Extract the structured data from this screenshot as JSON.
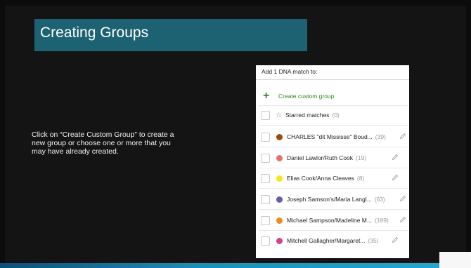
{
  "slide": {
    "title": "Creating Groups",
    "instruction_line1": "Click on “Create Custom Group” to create a",
    "instruction_line2": "new group or choose one or more that you",
    "instruction_line3": "may have already created."
  },
  "panel": {
    "header": "Add 1 DNA match to:",
    "create_label": "Create custom group",
    "starred": {
      "label": "Starred matches",
      "count": "(0)"
    },
    "groups": [
      {
        "label": "CHARLES \"dit Mississe\" Boud...",
        "count": "(39)",
        "color": "#9a4a12"
      },
      {
        "label": "Daniel Lawlor/Ruth Cook",
        "count": "(19)",
        "color": "#e86f6f"
      },
      {
        "label": "Elias Cook/Anna Cleaves",
        "count": "(8)",
        "color": "#f2e81a"
      },
      {
        "label": "Joseph Samson's/Maria Langl...",
        "count": "(63)",
        "color": "#6a5aa8"
      },
      {
        "label": "Michael Sampson/Madeline M...",
        "count": "(189)",
        "color": "#ee8a1c"
      },
      {
        "label": "Mitchell Gallagher/Margaret...",
        "count": "(35)",
        "color": "#d3418a"
      }
    ]
  },
  "colors": {
    "title_box": "#1d6272",
    "accent_green": "#2f8a1d",
    "bottom_bar": "#1b8fb5"
  },
  "icons": {
    "create": "plus-icon",
    "starred": "star-icon",
    "edit": "pencil-icon"
  }
}
